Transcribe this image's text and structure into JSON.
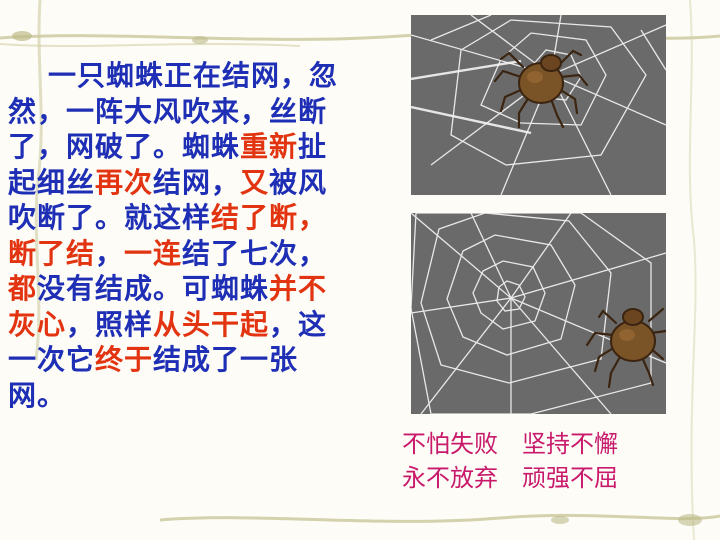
{
  "story": {
    "segments": [
      {
        "text": "一只蜘蛛正在结网，忽然，一阵大风吹来，丝断了，网破了。蜘蛛",
        "hl": false
      },
      {
        "text": "重新",
        "hl": true
      },
      {
        "text": "扯起细丝",
        "hl": false
      },
      {
        "text": "再次",
        "hl": true
      },
      {
        "text": "结网，",
        "hl": false
      },
      {
        "text": "又",
        "hl": true
      },
      {
        "text": "被风吹断了。就这样",
        "hl": false
      },
      {
        "text": "结了断，断了结",
        "hl": true
      },
      {
        "text": "，",
        "hl": false
      },
      {
        "text": "一连",
        "hl": true
      },
      {
        "text": "结了七次，",
        "hl": false
      },
      {
        "text": "都",
        "hl": true
      },
      {
        "text": "没有结成。可蜘蛛",
        "hl": false
      },
      {
        "text": "并不灰心",
        "hl": true
      },
      {
        "text": "，照样",
        "hl": false
      },
      {
        "text": "从头干起",
        "hl": true
      },
      {
        "text": "，这一次它",
        "hl": false
      },
      {
        "text": "终于",
        "hl": true
      },
      {
        "text": "结成了一张网。",
        "hl": false
      }
    ]
  },
  "mottos": [
    "不怕失败　坚持不懈",
    "永不放弃　顽强不屈"
  ],
  "colors": {
    "body_text": "#1e2fb5",
    "highlight": "#e23410",
    "motto": "#c8196b",
    "picture_bg": "#6a6a6a"
  },
  "icons": [
    "spider-icon",
    "spider-web-icon"
  ]
}
